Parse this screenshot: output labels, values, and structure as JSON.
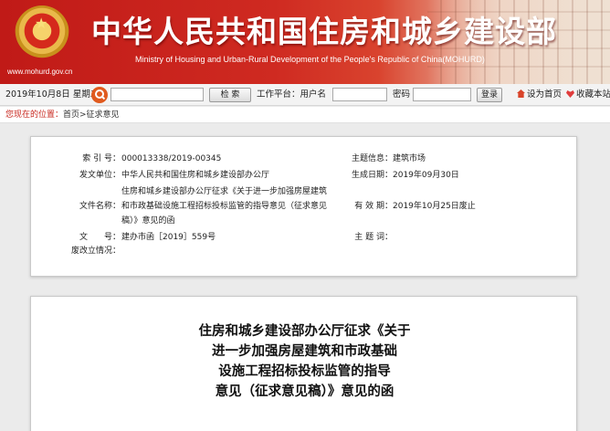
{
  "banner": {
    "title": "中华人民共和国住房和城乡建设部",
    "subtitle": "Ministry of Housing and Urban-Rural Development of the People's Republic of China(MOHURD)",
    "url": "www.mohurd.gov.cn",
    "brand_color": "#c01a17"
  },
  "toolbar": {
    "date": "2019年10月8日 星期二",
    "search_button": "检  索",
    "account_label": "工作平台：用户名",
    "password_label": "密码",
    "login_button": "登录",
    "homepage_link": "设为首页",
    "favorite_link": "收藏本站"
  },
  "breadcrumb": {
    "label": "您现在的位置：",
    "path": "首页>征求意见"
  },
  "info": {
    "index_label": "索 引 号：",
    "index_value": "000013338/2019-00345",
    "topic_label": "主题信息：",
    "topic_value": "建筑市场",
    "issuer_label": "发文单位：",
    "issuer_value": "中华人民共和国住房和城乡建设部办公厅",
    "date_label": "生成日期：",
    "date_value": "2019年09月30日",
    "filename_label": "文件名称：",
    "filename_lines": [
      "住房和城乡建设部办公厅征求《关于进一步加强房屋建筑",
      "和市政基础设施工程招标投标监管的指导意见（征求意见",
      "稿）》意见的函"
    ],
    "validity_label": "有 效 期：",
    "validity_value": "2019年10月25日废止",
    "docno_label": "文　　号：",
    "docno_value": "建办市函［2019］559号",
    "keywords_label": "主 题 词：",
    "status_label": "废改立情况："
  },
  "document": {
    "title_lines": [
      "住房和城乡建设部办公厅征求《关于",
      "进一步加强房屋建筑和市政基础",
      "设施工程招标投标监管的指导",
      "意见（征求意见稿）》意见的函"
    ]
  }
}
